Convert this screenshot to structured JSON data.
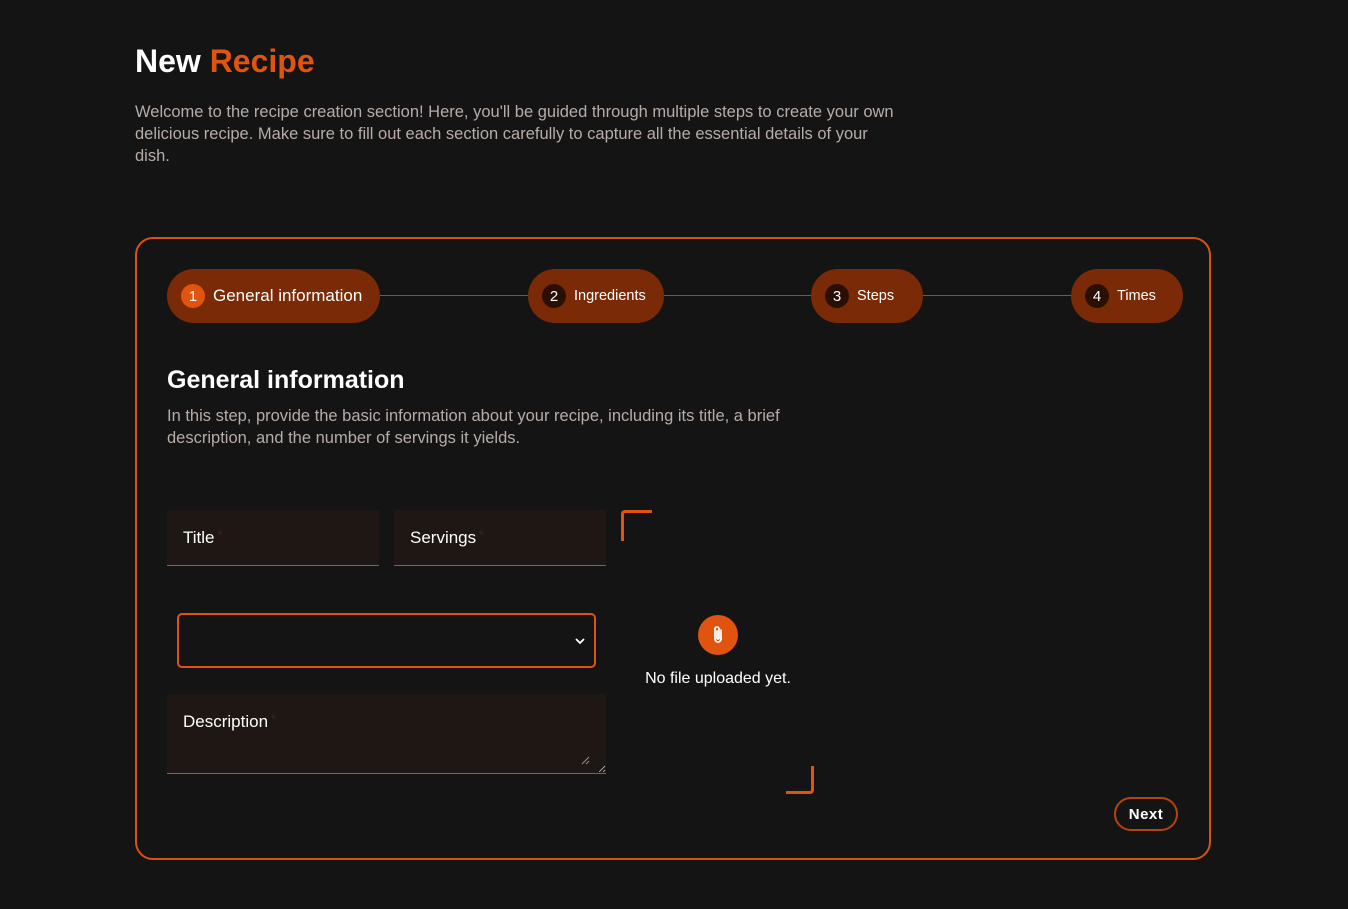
{
  "header": {
    "title_prefix": "New",
    "title_accent": "Recipe",
    "intro": "Welcome to the recipe creation section! Here, you'll be guided through multiple steps to create your own delicious recipe. Make sure to fill out each section carefully to capture all the essential details of your dish."
  },
  "stepper": {
    "active_step": 1,
    "steps": [
      {
        "number": "1",
        "label": "General information"
      },
      {
        "number": "2",
        "label": "Ingredients"
      },
      {
        "number": "3",
        "label": "Steps"
      },
      {
        "number": "4",
        "label": "Times"
      }
    ]
  },
  "section": {
    "title": "General information",
    "description": "In this step, provide the basic information about your recipe, including its title, a brief description, and the number of servings it yields."
  },
  "form": {
    "title_label": "Title",
    "servings_label": "Servings",
    "description_label": "Description",
    "required_marker": "*",
    "select_value": "",
    "select_chevron": "⌄"
  },
  "upload": {
    "icon": "paperclip-icon",
    "status": "No file uploaded yet."
  },
  "actions": {
    "next_label": "Next"
  },
  "colors": {
    "accent": "#e0540f",
    "step_bg": "#7a2a06",
    "background": "#141414",
    "field_bg": "#1f1714"
  }
}
